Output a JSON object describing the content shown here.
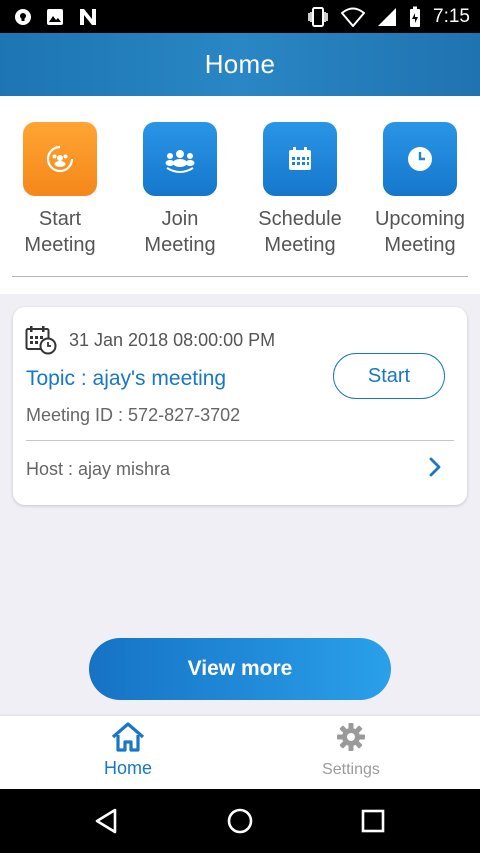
{
  "status_bar": {
    "time": "7:15",
    "left_icons": [
      "vpn-shield-icon",
      "image-icon",
      "n-icon"
    ],
    "right_icons": [
      "vibrate-icon",
      "wifi-icon",
      "signal-icon",
      "battery-icon"
    ]
  },
  "header": {
    "title": "Home"
  },
  "actions": [
    {
      "label": "Start\nMeeting",
      "icon": "start-meeting-icon",
      "color": "#f7921e"
    },
    {
      "label": "Join\nMeeting",
      "icon": "join-meeting-icon",
      "color": "#1e86d8"
    },
    {
      "label": "Schedule\nMeeting",
      "icon": "calendar-icon",
      "color": "#1e86d8"
    },
    {
      "label": "Upcoming\nMeeting",
      "icon": "clock-icon",
      "color": "#1e86d8"
    }
  ],
  "meeting_card": {
    "date": "31 Jan 2018 08:00:00 PM",
    "topic": "Topic : ajay's meeting",
    "meeting_id": "Meeting ID : 572-827-3702",
    "host": "Host : ajay mishra",
    "start_label": "Start"
  },
  "view_more_label": "View more",
  "tab_bar": {
    "home_label": "Home",
    "settings_label": "Settings",
    "active_color": "#1877c6",
    "inactive_color": "#9a9a9a"
  },
  "colors": {
    "accent": "#1877c6",
    "header": "#2a86c4",
    "background": "#efeff5",
    "orange": "#f7921e"
  }
}
